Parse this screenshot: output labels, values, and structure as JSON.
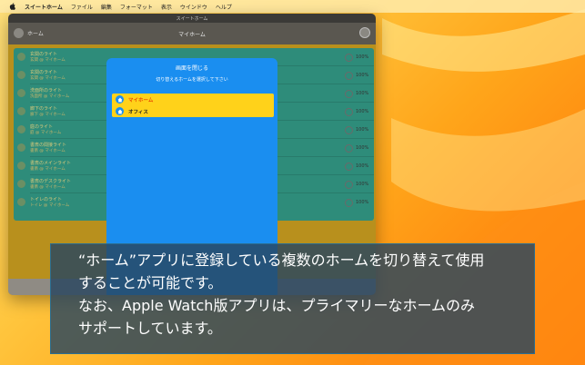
{
  "menubar": {
    "items": [
      "スイートホーム",
      "ファイル",
      "編集",
      "フォーマット",
      "表示",
      "ウインドウ",
      "ヘルプ"
    ]
  },
  "window": {
    "title": "スイートホーム",
    "toolbar": {
      "left_button": "ホーム",
      "title": "マイホーム"
    },
    "rows": [
      {
        "name": "玄関のライト",
        "sub": "玄関 @ マイホーム",
        "pct": "100%"
      },
      {
        "name": "玄関のライト",
        "sub": "玄関 @ マイホーム",
        "pct": "100%"
      },
      {
        "name": "洗面所のライト",
        "sub": "洗面所 @ マイホーム",
        "pct": "100%"
      },
      {
        "name": "廊下のライト",
        "sub": "廊下 @ マイホーム",
        "pct": "100%"
      },
      {
        "name": "庭のライト",
        "sub": "庭 @ マイホーム",
        "pct": "100%"
      },
      {
        "name": "書斎の間接ライト",
        "sub": "書斎 @ マイホーム",
        "pct": "100%"
      },
      {
        "name": "書斎のメインライト",
        "sub": "書斎 @ マイホーム",
        "pct": "100%"
      },
      {
        "name": "書斎のデスクライト",
        "sub": "書斎 @ マイホーム",
        "pct": "100%"
      },
      {
        "name": "トイレのライト",
        "sub": "トイレ @ マイホーム",
        "pct": "100%"
      }
    ]
  },
  "sheet": {
    "close_label": "画面を閉じる",
    "instruction": "切り替えるホームを選択して下さい",
    "options": [
      {
        "label": "マイホーム",
        "selected": true
      },
      {
        "label": "オフィス",
        "selected": false
      }
    ]
  },
  "caption": {
    "lines": [
      "“ホーム”アプリに登録している複数のホームを切り替えて使用",
      "することが可能です。",
      "なお、Apple Watch版アプリは、プライマリーなホームのみ",
      "サポートしています。"
    ]
  },
  "colors": {
    "sheet_blue": "#1a8ef0",
    "option_yellow": "#ffd21a",
    "selected_text": "#e84a00",
    "list_teal": "#2e8c7a"
  }
}
